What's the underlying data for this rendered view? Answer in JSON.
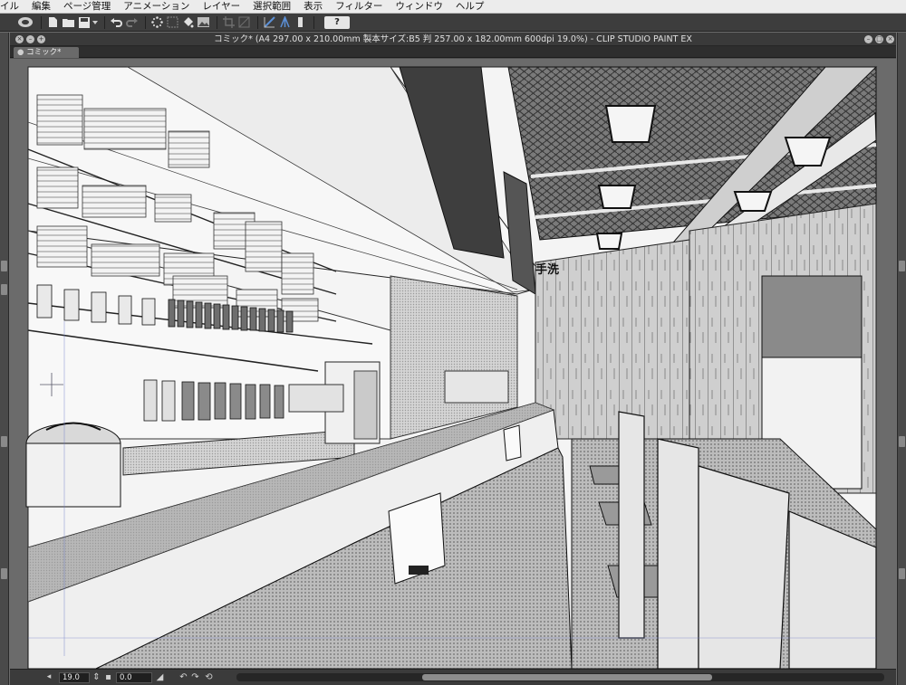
{
  "menubar": {
    "items": [
      "イル",
      "編集",
      "ページ管理",
      "アニメーション",
      "レイヤー",
      "選択範囲",
      "表示",
      "フィルター",
      "ウィンドウ",
      "ヘルプ"
    ]
  },
  "toolbar": {
    "help_label": "?"
  },
  "window": {
    "title": "コミック* (A4 297.00 x 210.00mm 製本サイズ:B5 判 257.00 x 182.00mm 600dpi 19.0%) - CLIP STUDIO PAINT EX",
    "tab_label": "コミック*"
  },
  "status": {
    "zoom": "19.0",
    "angle": "0.0"
  },
  "canvas": {
    "sign_text": "手洗"
  }
}
